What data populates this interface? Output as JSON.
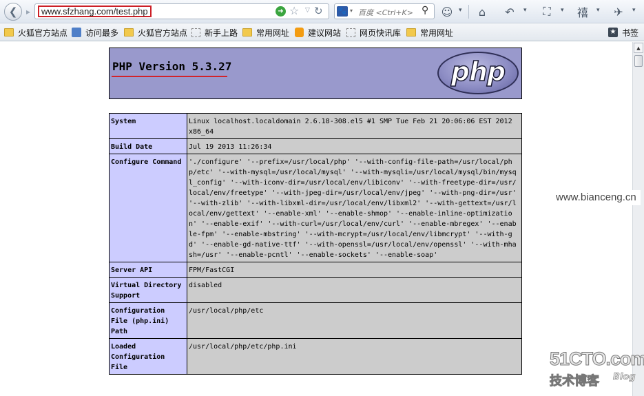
{
  "toolbar": {
    "back_glyph": "❮",
    "forward_glyph": "▸",
    "url": "www.sfzhang.com/test.php",
    "go_glyph": "➜",
    "star_glyph": "☆",
    "dropdown_glyph": "▽",
    "reload_glyph": "↻",
    "search_engine_glyph": "🐾",
    "search_placeholder": "百度 <Ctrl+K>",
    "search_glyph": "⚲",
    "tool_glyphs": {
      "addon": "☺",
      "home": "⌂",
      "undo": "↶",
      "screenshot": "⛶",
      "translate": "禧",
      "tools": "✈",
      "dropdown": "▾"
    }
  },
  "bookmarks": {
    "items": [
      {
        "label": "火狐官方站点",
        "icon": "folder-icon"
      },
      {
        "label": "访问最多",
        "icon": "history-icon"
      },
      {
        "label": "火狐官方站点",
        "icon": "folder-icon"
      },
      {
        "label": "新手上路",
        "icon": "dashed-icon"
      },
      {
        "label": "常用网址",
        "icon": "folder-icon"
      },
      {
        "label": "建议网站",
        "icon": "bulb-icon"
      },
      {
        "label": "网页快讯库",
        "icon": "dashed-icon"
      },
      {
        "label": "常用网址",
        "icon": "folder-icon"
      }
    ],
    "right_label": "书签",
    "right_icon": "bookmark-star-icon"
  },
  "page": {
    "php_version": "PHP Version 5.3.27",
    "logo_text": "php",
    "rows": [
      {
        "key": "System",
        "value": "Linux localhost.localdomain 2.6.18-308.el5 #1 SMP Tue Feb 21 20:06:06 EST 2012 x86_64"
      },
      {
        "key": "Build Date",
        "value": "Jul 19 2013 11:26:34"
      },
      {
        "key": "Configure Command",
        "value": "'./configure' '--prefix=/usr/local/php' '--with-config-file-path=/usr/local/php/etc' '--with-mysql=/usr/local/mysql' '--with-mysqli=/usr/local/mysql/bin/mysql_config' '--with-iconv-dir=/usr/local/env/libiconv' '--with-freetype-dir=/usr/local/env/freetype' '--with-jpeg-dir=/usr/local/env/jpeg' '--with-png-dir=/usr' '--with-zlib' '--with-libxml-dir=/usr/local/env/libxml2' '--with-gettext=/usr/local/env/gettext' '--enable-xml' '--enable-shmop' '--enable-inline-optimization' '--enable-exif' '--with-curl=/usr/local/env/curl' '--enable-mbregex' '--enable-fpm' '--enable-mbstring' '--with-mcrypt=/usr/local/env/libmcrypt' '--with-gd' '--enable-gd-native-ttf' '--with-openssl=/usr/local/env/openssl' '--with-mhash=/usr' '--enable-pcntl' '--enable-sockets' '--enable-soap'"
      },
      {
        "key": "Server API",
        "value": "FPM/FastCGI"
      },
      {
        "key": "Virtual Directory Support",
        "value": "disabled"
      },
      {
        "key": "Configuration File (php.ini) Path",
        "value": "/usr/local/php/etc"
      },
      {
        "key": "Loaded Configuration File",
        "value": "/usr/local/php/etc/php.ini"
      }
    ]
  },
  "watermarks": {
    "site": "www.bianceng.cn",
    "brand": "51CTO.com",
    "blog_cn": "技术博客",
    "blog_en": "Blog"
  },
  "scrollbar": {
    "up_glyph": "▲"
  }
}
